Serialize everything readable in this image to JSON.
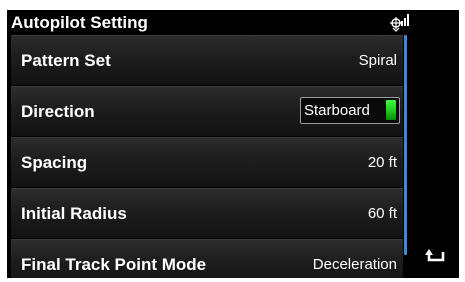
{
  "header": {
    "title": "Autopilot Setting",
    "status_icon": "autopilot-signal-icon"
  },
  "rows": [
    {
      "label": "Pattern Set",
      "value": "Spiral"
    },
    {
      "label": "Direction",
      "value": "Starboard",
      "indicator_color": "#2fd62f"
    },
    {
      "label": "Spacing",
      "value": "20 ft"
    },
    {
      "label": "Initial Radius",
      "value": "60 ft"
    },
    {
      "label": "Final Track Point Mode",
      "value": "Deceleration"
    }
  ],
  "back_icon": "back-arrow-icon",
  "colors": {
    "background": "#000000",
    "text": "#ffffff",
    "scrollbar": "#3a8ad8",
    "indicator": "#2fd62f"
  }
}
